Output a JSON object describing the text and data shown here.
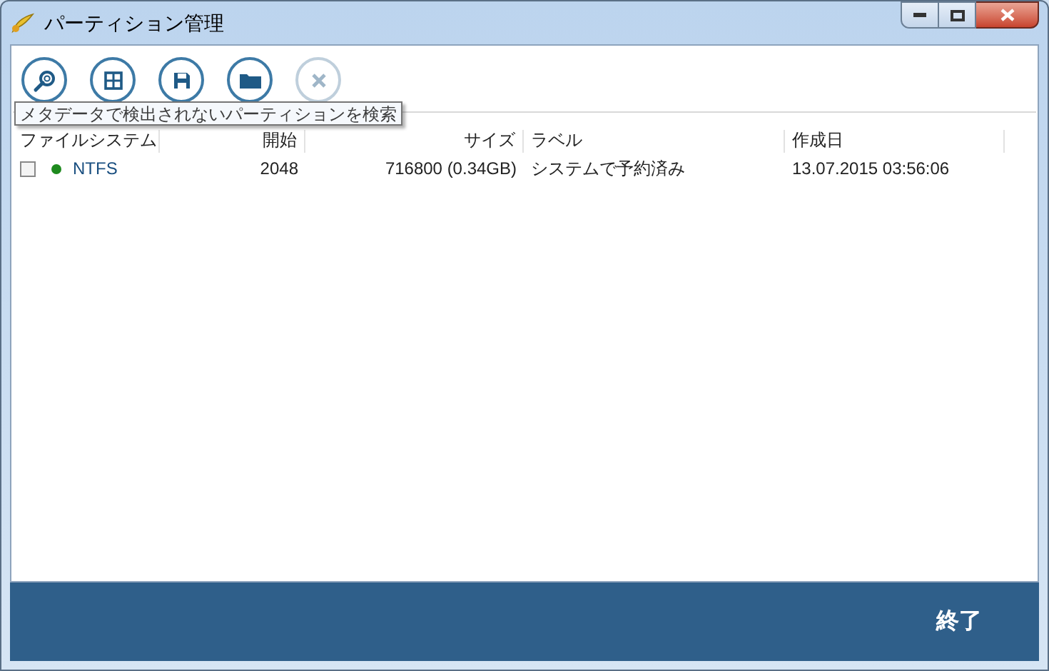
{
  "window": {
    "title": "パーティション管理"
  },
  "toolbar": [
    {
      "kind": "search",
      "disabled": false
    },
    {
      "kind": "grid",
      "disabled": false
    },
    {
      "kind": "save",
      "disabled": false
    },
    {
      "kind": "folder",
      "disabled": false
    },
    {
      "kind": "close",
      "disabled": true
    }
  ],
  "tooltip": "メタデータで検出されないパーティションを検索",
  "table": {
    "columns": [
      "ファイルシステム",
      "開始",
      "サイズ",
      "ラベル",
      "作成日"
    ],
    "rows": [
      {
        "checked": false,
        "color": "#1e8a1e",
        "cells": [
          "NTFS",
          "2048",
          "716800 (0.34GB)",
          "システムで予約済み",
          "13.07.2015 03:56:06"
        ]
      }
    ]
  },
  "footer": {
    "button": "終了"
  }
}
